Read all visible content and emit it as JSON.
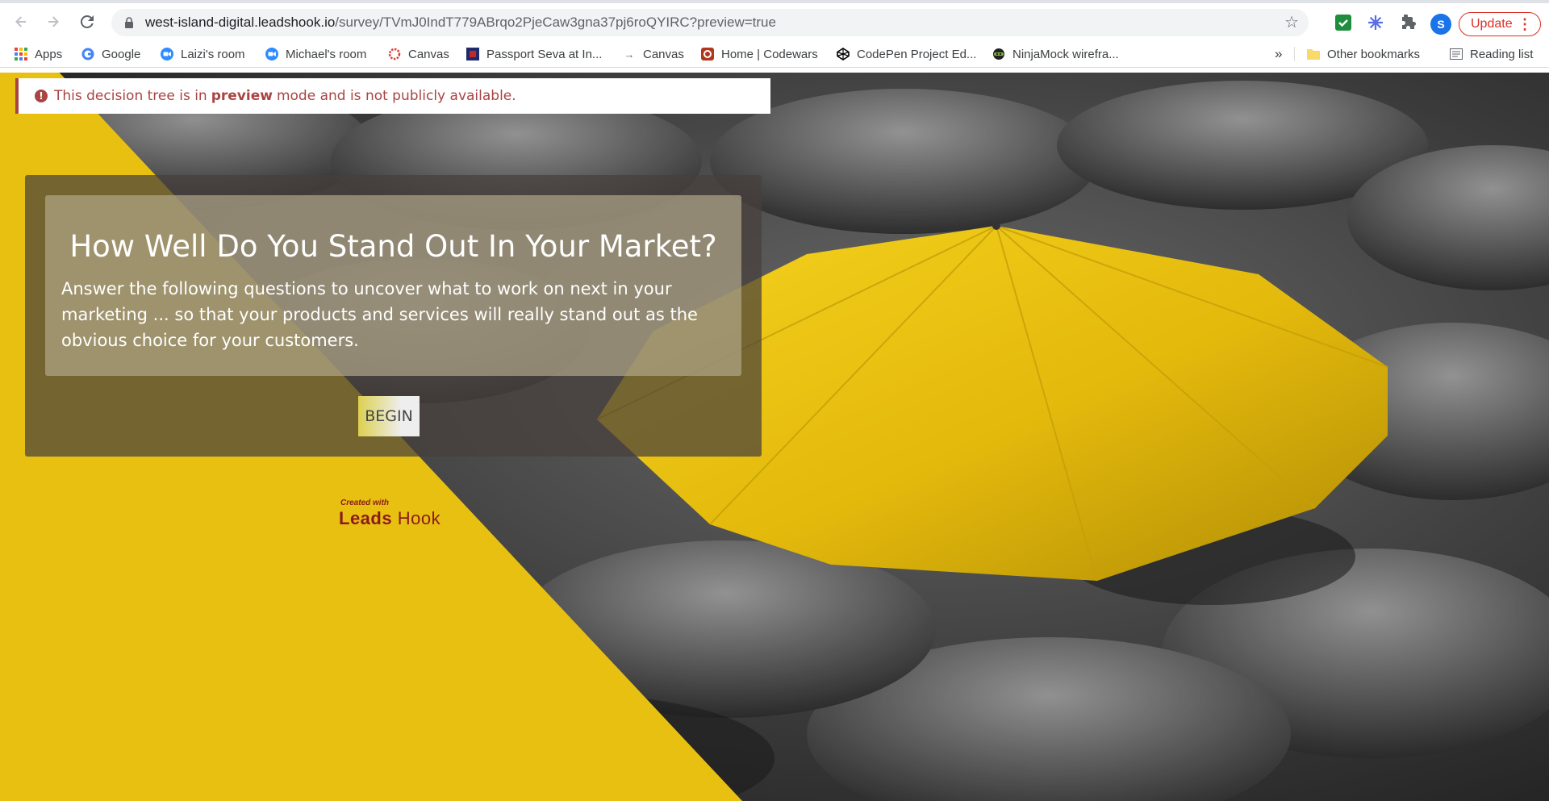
{
  "browser": {
    "url_host": "west-island-digital.leadshook.io",
    "url_path": "/survey/TVmJ0IndT779ABrqo2PjeCaw3gna37pj6roQYIRC?preview=true",
    "profile_initial": "S",
    "update_label": "Update",
    "bookmarks": [
      {
        "label": "Apps",
        "icon": "apps-grid-icon"
      },
      {
        "label": "Google",
        "icon": "google-icon"
      },
      {
        "label": "Laizi's room",
        "icon": "zoom-icon"
      },
      {
        "label": "Michael's room",
        "icon": "zoom-icon"
      },
      {
        "label": "Canvas",
        "icon": "canvas-icon"
      },
      {
        "label": "Passport Seva at In...",
        "icon": "passport-seva-icon"
      },
      {
        "label": "Canvas",
        "icon": "arrow-icon"
      },
      {
        "label": "Home | Codewars",
        "icon": "codewars-icon"
      },
      {
        "label": "CodePen Project Ed...",
        "icon": "codepen-icon"
      },
      {
        "label": "NinjaMock wirefra...",
        "icon": "ninjamock-icon"
      }
    ],
    "overflow_label": "»",
    "other_bookmarks": "Other bookmarks",
    "reading_list": "Reading list"
  },
  "banner": {
    "pre": "This decision tree is in",
    "bold": "preview",
    "post": "mode and is not publicly available."
  },
  "card": {
    "title": "How Well Do You Stand Out In Your Market?",
    "text": "Answer the following questions to uncover what to work on next in your marketing ... so that your products and services will really stand out as the obvious choice for your customers.",
    "button": "BEGIN"
  },
  "logo": {
    "small": "Created with",
    "leads": "Leads",
    "hook": "Hook"
  },
  "colors": {
    "accent_yellow": "#e8c012",
    "alert_red": "#a94442",
    "update_red": "#d93025"
  }
}
